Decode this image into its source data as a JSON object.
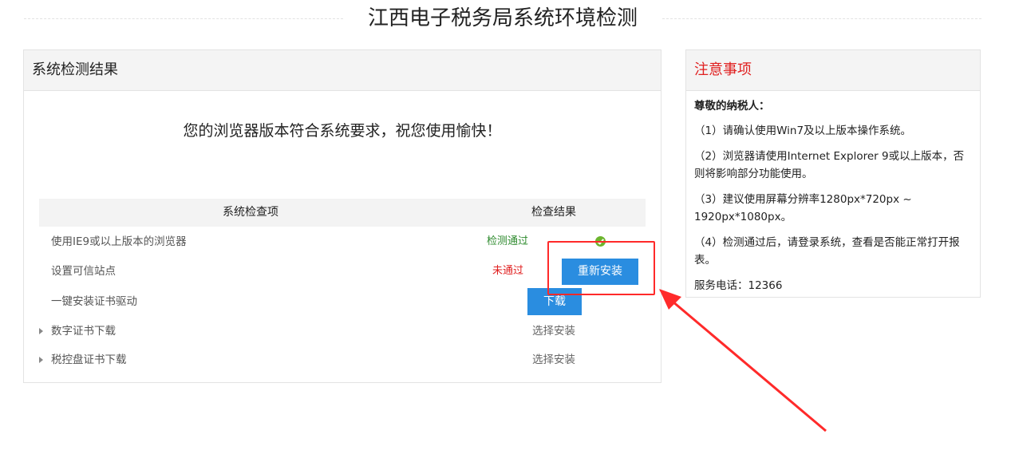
{
  "header": {
    "title": "江西电子税务局系统环境检测"
  },
  "main": {
    "panel_title": "系统检测结果",
    "success_message": "您的浏览器版本符合系统要求，祝您使用愉快！",
    "table": {
      "col_item": "系统检查项",
      "col_result": "检查结果",
      "rows": [
        {
          "name": "使用IE9或以上版本的浏览器",
          "status": "检测通过"
        },
        {
          "name": "设置可信站点",
          "status": "未通过",
          "action": "重新安装"
        },
        {
          "name": "一键安装证书驱动",
          "action": "下载"
        },
        {
          "name": "数字证书下载",
          "action": "选择安装"
        },
        {
          "name": "税控盘证书下载",
          "action": "选择安装"
        }
      ]
    }
  },
  "notice": {
    "title": "注意事项",
    "greeting": "尊敬的纳税人：",
    "items": [
      "（1）请确认使用Win7及以上版本操作系统。",
      "（2）浏览器请使用Internet Explorer 9或以上版本，否则将影响部分功能使用。",
      "（3）建议使用屏幕分辨率1280px*720px ~ 1920px*1080px。",
      "（4）检测通过后，请登录系统，查看是否能正常打开报表。"
    ],
    "phone": "服务电话：12366"
  },
  "colors": {
    "accent_blue": "#2a8de0",
    "pass_green": "#2e8b2e",
    "fail_red": "#e02020",
    "annotation_red": "#ff2a2a"
  }
}
